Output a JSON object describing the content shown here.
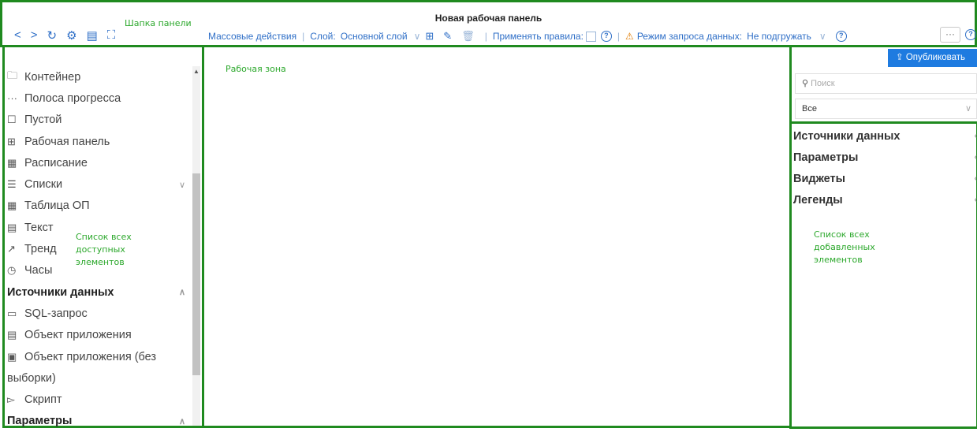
{
  "header": {
    "title": "Новая рабочая панель",
    "annotation": "Шапка панели",
    "nav": [
      {
        "icon": "back-icon",
        "glyph": "<"
      },
      {
        "icon": "forward-icon",
        "glyph": ">"
      },
      {
        "icon": "history-icon",
        "glyph": "↻"
      },
      {
        "icon": "settings-icon",
        "glyph": "⚙"
      },
      {
        "icon": "notebook-icon",
        "glyph": "▤"
      },
      {
        "icon": "fullscreen-icon",
        "glyph": "⛶"
      }
    ],
    "toolbar": {
      "bulk_actions": "Массовые действия",
      "layer_label": "Слой:",
      "layer_value": "Основной слой",
      "apply_rules": "Применять правила:",
      "query_mode_label": "Режим запроса данных:",
      "query_mode_value": "Не подгружать"
    },
    "more": "···"
  },
  "left": {
    "annotation": "Список всех доступных элементов",
    "items": [
      {
        "icon": "container-icon",
        "glyph": "🗀",
        "label": "Контейнер"
      },
      {
        "icon": "progress-bar-icon",
        "glyph": "···",
        "label": "Полоса прогресса"
      },
      {
        "icon": "empty-icon",
        "glyph": "☐",
        "label": "Пустой"
      },
      {
        "icon": "dashboard-icon",
        "glyph": "⊞",
        "label": "Рабочая панель"
      },
      {
        "icon": "schedule-icon",
        "glyph": "▦",
        "label": "Расписание"
      },
      {
        "icon": "list-icon",
        "glyph": "☰",
        "label": "Списки"
      },
      {
        "icon": "table-icon",
        "glyph": "▦",
        "label": "Таблица ОП"
      },
      {
        "icon": "text-icon",
        "glyph": "▤",
        "label": "Текст"
      },
      {
        "icon": "trend-icon",
        "glyph": "↗",
        "label": "Тренд"
      },
      {
        "icon": "clock-icon",
        "glyph": "◷",
        "label": "Часы"
      }
    ],
    "section_sources": "Источники данных",
    "sources": [
      {
        "icon": "sql-icon",
        "glyph": "▭",
        "label": "SQL-запрос"
      },
      {
        "icon": "app-object-icon",
        "glyph": "▤",
        "label": "Объект приложения"
      },
      {
        "icon": "app-object-noselect-icon",
        "glyph": "▣",
        "label": "Объект приложения (без"
      },
      {
        "icon": "",
        "glyph": "",
        "label": "выборки)"
      },
      {
        "icon": "script-icon",
        "glyph": "▻",
        "label": "Скрипт"
      }
    ],
    "section_params": "Параметры"
  },
  "work": {
    "annotation": "Рабочая зона"
  },
  "right": {
    "publish": "Опубликовать",
    "search_placeholder": "Поиск",
    "filter_value": "Все",
    "sections": [
      "Источники данных",
      "Параметры",
      "Виджеты",
      "Легенды"
    ],
    "annotation": "Список всех добавленных элементов"
  }
}
